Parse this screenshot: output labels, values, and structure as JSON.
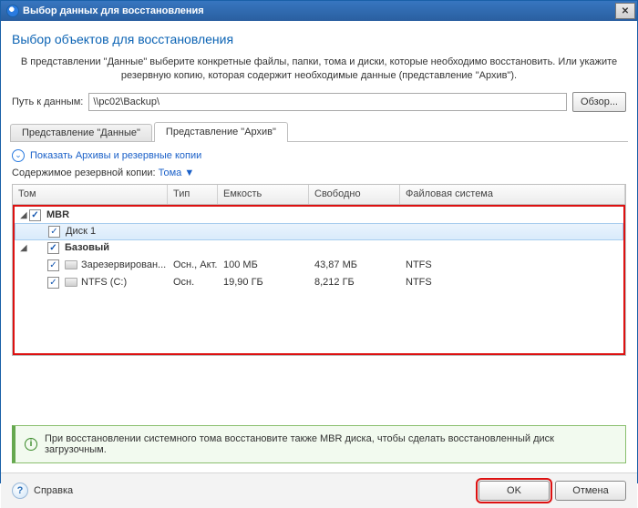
{
  "title": "Выбор данных для восстановления",
  "header": "Выбор объектов для восстановления",
  "description": "В представлении \"Данные\" выберите конкретные файлы, папки, тома и диски, которые необходимо восстановить. Или укажите резервную копию, которая содержит необходимые данные (представление \"Архив\").",
  "path": {
    "label": "Путь к данным:",
    "value": "\\\\pc02\\Backup\\",
    "browse": "Обзор..."
  },
  "tabs": {
    "data": "Представление \"Данные\"",
    "archive": "Представление \"Архив\""
  },
  "link": "Показать Архивы и резервные копии",
  "content_label": "Содержимое резервной копии:",
  "content_dd": "Тома ▼",
  "cols": {
    "c1": "Том",
    "c2": "Тип",
    "c3": "Емкость",
    "c4": "Свободно",
    "c5": "Файловая система"
  },
  "rows": {
    "g1": "MBR",
    "g1a": "Диск 1",
    "g2": "Базовый",
    "r1": {
      "name": "Зарезервирован...",
      "type": "Осн., Акт.",
      "cap": "100 МБ",
      "free": "43,87 МБ",
      "fs": "NTFS"
    },
    "r2": {
      "name": "NTFS (C:)",
      "type": "Осн.",
      "cap": "19,90 ГБ",
      "free": "8,212 ГБ",
      "fs": "NTFS"
    }
  },
  "info": "При восстановлении системного тома восстановите также MBR диска, чтобы сделать восстановленный диск загрузочным.",
  "buttons": {
    "help": "Справка",
    "ok": "OK",
    "cancel": "Отмена"
  }
}
